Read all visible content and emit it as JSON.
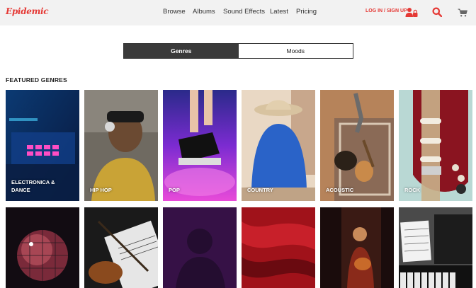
{
  "header": {
    "logo_text": "Epidemic",
    "nav": [
      {
        "label": "Browse"
      },
      {
        "label": "Albums"
      },
      {
        "label": "Sound Effects"
      },
      {
        "label": "Latest"
      },
      {
        "label": "Pricing"
      }
    ],
    "login_label": "LOG IN / SIGN UP",
    "icons": [
      "user-lock-icon",
      "search-icon",
      "cart-icon"
    ]
  },
  "tabs": [
    {
      "label": "Genres",
      "active": true
    },
    {
      "label": "Moods",
      "active": false
    }
  ],
  "featured": {
    "title": "FEATURED GENRES",
    "genres_row1": [
      {
        "label": "ELECTRONICA &\nDANCE"
      },
      {
        "label": "HIP HOP"
      },
      {
        "label": "POP"
      },
      {
        "label": "COUNTRY"
      },
      {
        "label": "ACOUSTIC"
      },
      {
        "label": "ROCK"
      }
    ]
  },
  "colors": {
    "brand_red": "#e53935",
    "active_tab": "#3a3a3a",
    "header_bg": "#f2f2f2"
  }
}
